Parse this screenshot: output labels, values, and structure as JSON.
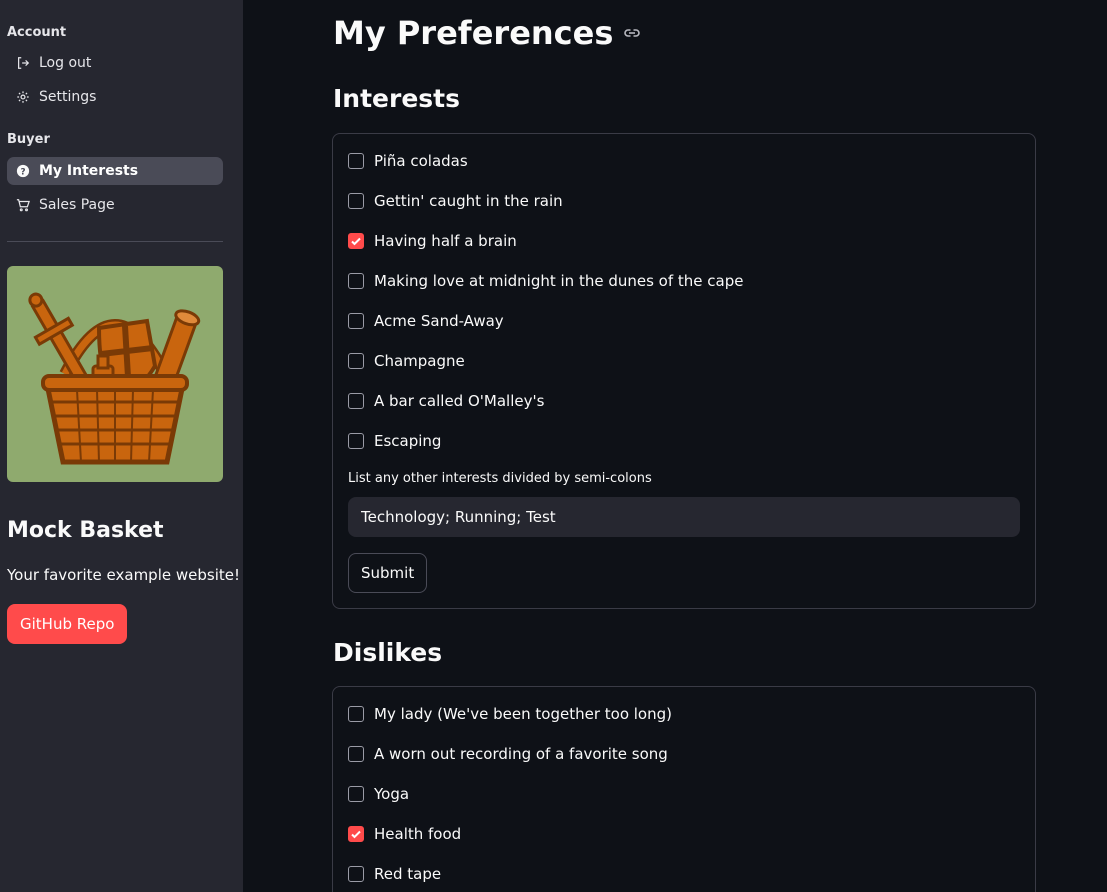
{
  "sidebar": {
    "account_header": "Account",
    "account_items": [
      {
        "label": "Log out",
        "icon": "logout-icon"
      },
      {
        "label": "Settings",
        "icon": "gear-icon"
      }
    ],
    "buyer_header": "Buyer",
    "buyer_items": [
      {
        "label": "My Interests",
        "icon": "help-circle-icon",
        "active": true
      },
      {
        "label": "Sales Page",
        "icon": "cart-icon",
        "active": false
      }
    ],
    "brand_title": "Mock Basket",
    "brand_subtitle": "Your favorite example website!",
    "github_button": "GitHub Repo"
  },
  "main": {
    "page_title": "My Preferences",
    "interests": {
      "title": "Interests",
      "items": [
        {
          "label": "Piña coladas",
          "checked": false
        },
        {
          "label": "Gettin' caught in the rain",
          "checked": false
        },
        {
          "label": "Having half a brain",
          "checked": true
        },
        {
          "label": "Making love at midnight in the dunes of the cape",
          "checked": false
        },
        {
          "label": "Acme Sand-Away",
          "checked": false
        },
        {
          "label": "Champagne",
          "checked": false
        },
        {
          "label": "A bar called O'Malley's",
          "checked": false
        },
        {
          "label": "Escaping",
          "checked": false
        }
      ],
      "other_label": "List any other interests divided by semi-colons",
      "other_value": "Technology; Running; Test",
      "submit_label": "Submit"
    },
    "dislikes": {
      "title": "Dislikes",
      "items": [
        {
          "label": "My lady (We've been together too long)",
          "checked": false
        },
        {
          "label": "A worn out recording of a favorite song",
          "checked": false
        },
        {
          "label": "Yoga",
          "checked": false
        },
        {
          "label": "Health food",
          "checked": true
        },
        {
          "label": "Red tape",
          "checked": false
        }
      ]
    }
  },
  "colors": {
    "accent": "#ff4b4b",
    "background": "#0e1117",
    "sidebar": "#262730",
    "logo_bg": "#8faa6e"
  }
}
